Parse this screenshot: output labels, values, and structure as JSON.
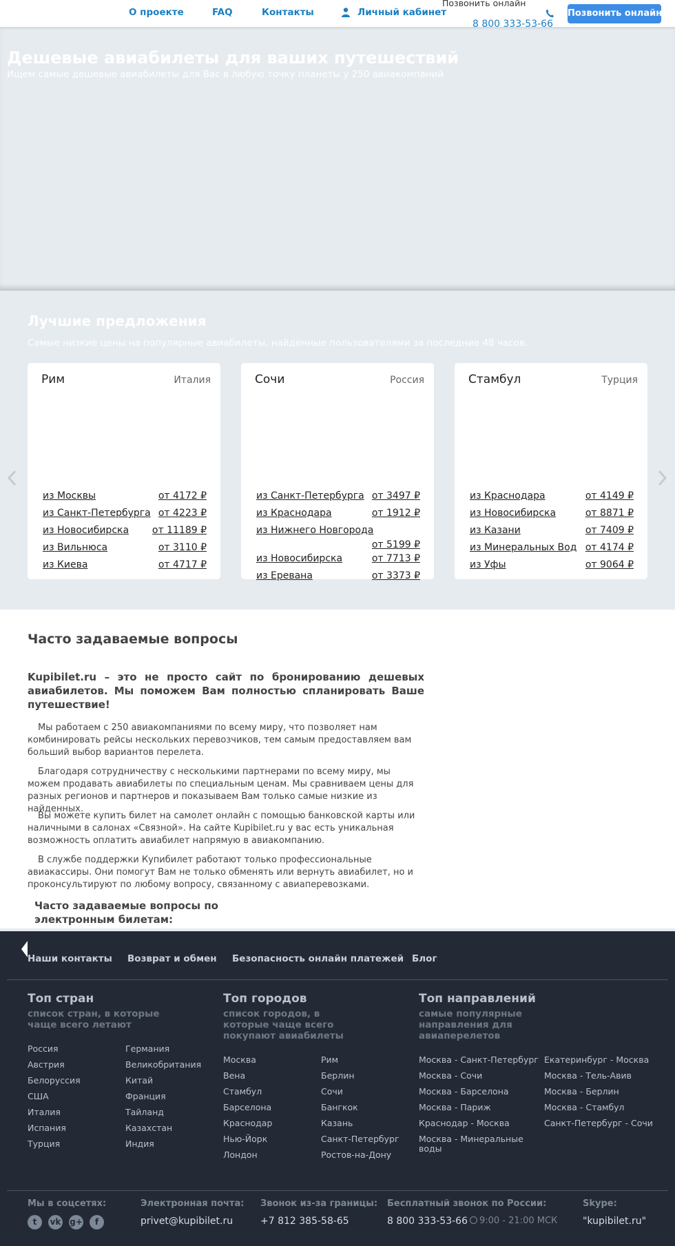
{
  "header": {
    "nav": [
      "О проекте",
      "FAQ",
      "Контакты"
    ],
    "cabinet": "Личный кабинет",
    "call_label": "Позвонить онлайн",
    "phone": "8 800 333-53-66",
    "call_button": "Позвонить онлайн",
    "accent_color": "#1b7fc2",
    "button_color": "#3d8de6"
  },
  "hero": {
    "title": "Дешевые авиабилеты для ваших путешествий",
    "subtitle": "Ищем самые дешевые авиабилеты для Вас в любую точку планеты у 250 авиакомпаний"
  },
  "offers": {
    "title": "Лучшие предложения",
    "subtitle": "Самые низкие цены на популярные авиабилеты, найденные пользователями за последние 48 часов.",
    "cards": [
      {
        "city": "Рим",
        "country": "Италия",
        "routes": [
          {
            "from": "из Москвы",
            "price": "от 4172 ₽"
          },
          {
            "from": "из Санкт-Петербурга",
            "price": "от 4223 ₽"
          },
          {
            "from": "из Новосибирска",
            "price": "от 11189 ₽"
          },
          {
            "from": "из Вильнюса",
            "price": "от 3110 ₽"
          },
          {
            "from": "из Киева",
            "price": "от 4717 ₽"
          }
        ]
      },
      {
        "city": "Сочи",
        "country": "Россия",
        "routes": [
          {
            "from": "из Санкт-Петербурга",
            "price": "от 3497 ₽"
          },
          {
            "from": "из Краснодара",
            "price": "от 1912 ₽"
          },
          {
            "from": "из Нижнего Новгорода",
            "price": "от 5199 ₽"
          },
          {
            "from": "из Новосибирска",
            "price": "от 7713 ₽"
          },
          {
            "from": "из Еревана",
            "price": "от 3373 ₽"
          }
        ]
      },
      {
        "city": "Стамбул",
        "country": "Турция",
        "routes": [
          {
            "from": "из Краснодара",
            "price": "от 4149 ₽"
          },
          {
            "from": "из Новосибирска",
            "price": "от 8871 ₽"
          },
          {
            "from": "из Казани",
            "price": "от 7409 ₽"
          },
          {
            "from": "из Минеральных Вод",
            "price": "от 4174 ₽"
          },
          {
            "from": "из Уфы",
            "price": "от 9064 ₽"
          }
        ]
      }
    ]
  },
  "faq": {
    "title": "Часто задаваемые вопросы",
    "lead": "Kupibilet.ru – это не просто сайт по бронированию дешевых авиабилетов. Мы поможем Вам полностью спланировать Ваше путешествие!",
    "paragraphs": [
      "Мы работаем с 250 авиакомпаниями по всему миру, что позволяет нам комбинировать рейсы нескольких перевозчиков, тем самым предоставляем вам больший выбор вариантов перелета.",
      "Благодаря сотрудничеству с несколькими партнерами по всему миру, мы можем продавать авиабилеты по специальным ценам. Мы сравниваем цены для разных регионов и партнеров и показываем Вам только самые низкие из найденных.",
      "Вы можете купить билет на самолет онлайн с помощью банковской карты или наличными в салонах «Связной». На сайте Kupibilet.ru у вас есть уникальная возможность оплатить авиабилет напрямую в авиакомпанию.",
      "В службе поддержки Купибилет работают только профессиональные авиакассиры. Они помогут Вам не только обменять или вернуть авиабилет, но и проконсультируют по любому вопросу, связанному с авиаперевозками."
    ],
    "subheading": "Часто задаваемые вопросы по электронным билетам:"
  },
  "footer": {
    "links": [
      "Наши контакты",
      "Возврат и обмен",
      "Безопасность онлайн платежей",
      "Блог"
    ],
    "columns": [
      {
        "title": "Топ стран",
        "subtitle": "список стран, в которые чаще всего летают",
        "items": [
          "Россия",
          "Австрия",
          "Белоруссия",
          "США",
          "Италия",
          "Испания",
          "Турция",
          "Германия",
          "Великобритания",
          "Китай",
          "Франция",
          "Тайланд",
          "Казахстан",
          "Индия"
        ]
      },
      {
        "title": "Топ городов",
        "subtitle": "список городов, в которые чаще всего покупают авиабилеты",
        "items": [
          "Москва",
          "Вена",
          "Стамбул",
          "Барселона",
          "Краснодар",
          "Нью-Йорк",
          "Лондон",
          "Рим",
          "Берлин",
          "Сочи",
          "Бангкок",
          "Казань",
          "Санкт-Петербург",
          "Ростов-на-Дону"
        ]
      },
      {
        "title": "Топ направлений",
        "subtitle": "самые популярные направления для авиаперелетов",
        "items": [
          "Москва - Санкт-Петербург",
          "Москва - Сочи",
          "Москва - Барселона",
          "Москва - Париж",
          "Краснодар - Москва",
          "Москва - Минеральные воды",
          "Екатеринбург - Москва",
          "Москва - Тель-Авив",
          "Москва - Берлин",
          "Москва - Стамбул",
          "Санкт-Петербург - Сочи"
        ]
      }
    ],
    "contacts": {
      "social_label": "Мы в соцсетях:",
      "social_icons": [
        "twitter-icon",
        "vk-icon",
        "google-plus-icon",
        "facebook-icon"
      ],
      "email_label": "Электронная почта:",
      "email": "privet@kupibilet.ru",
      "intl_label": "Звонок из-за границы:",
      "intl_phone": "+7 812 385-58-65",
      "free_label": "Бесплатный звонок по России:",
      "free_phone": "8 800 333-53-66",
      "hours": "9:00 - 21:00 МСК",
      "skype_label": "Skype:",
      "skype": "\"kupibilet.ru\""
    }
  }
}
